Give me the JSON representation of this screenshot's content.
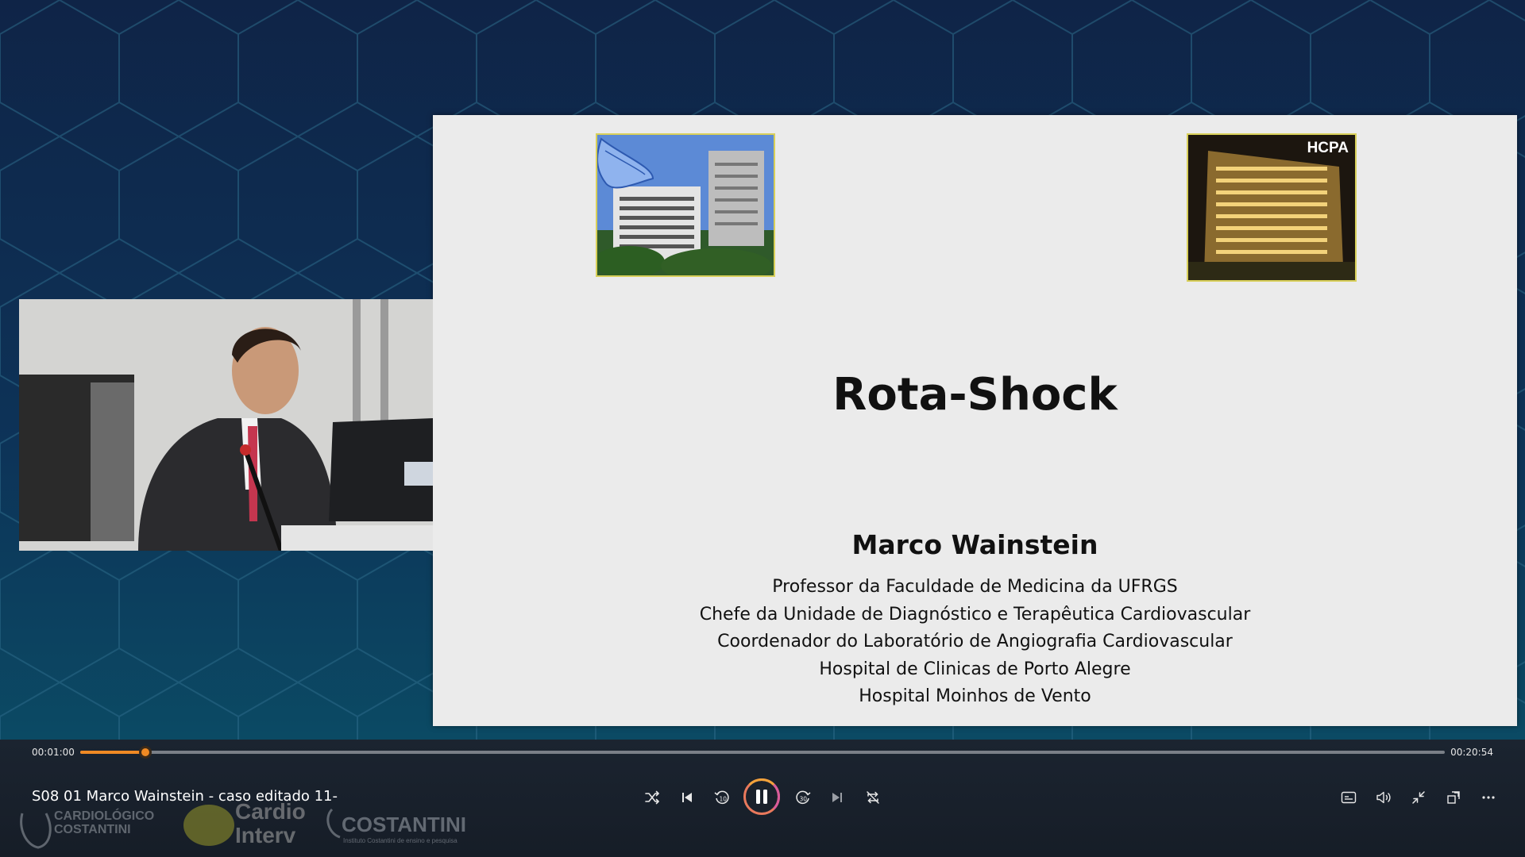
{
  "slide": {
    "title": "Rota-Shock",
    "presenter": "Marco Wainstein",
    "affiliations": [
      "Professor da Faculdade de Medicina da UFRGS",
      "Chefe da Unidade de Diagnóstico e Terapêutica Cardiovascular",
      "Coordenador do Laboratório de Angiografia Cardiovascular",
      "Hospital de Clinicas de Porto Alegre",
      "Hospital Moinhos de Vento"
    ],
    "right_photo_label": "HCPA"
  },
  "player": {
    "current_time": "00:01:00",
    "total_time": "00:20:54",
    "progress": 0.048,
    "video_title": "S08 01 Marco Wainstein - caso editado 11-",
    "accent_color": "#f08a24",
    "controls": [
      {
        "name": "shuffle",
        "icon": "shuffle-icon"
      },
      {
        "name": "previous",
        "icon": "skip-previous-icon"
      },
      {
        "name": "rewind-10",
        "icon": "rewind-10-icon"
      },
      {
        "name": "pause",
        "icon": "pause-icon"
      },
      {
        "name": "forward-30",
        "icon": "forward-30-icon"
      },
      {
        "name": "next",
        "icon": "skip-next-icon"
      },
      {
        "name": "repeat-off",
        "icon": "repeat-off-icon"
      }
    ],
    "right_controls": [
      {
        "name": "captions",
        "icon": "captions-icon"
      },
      {
        "name": "volume",
        "icon": "volume-icon"
      },
      {
        "name": "exit-fullscreen",
        "icon": "exit-fullscreen-icon"
      },
      {
        "name": "mini-player",
        "icon": "mini-player-icon"
      },
      {
        "name": "more",
        "icon": "more-icon"
      }
    ],
    "rewind_seconds": "10",
    "forward_seconds": "30"
  },
  "watermark_logos": {
    "logo1": [
      "CARDIOLÓGICO",
      "COSTANTINI"
    ],
    "logo2": [
      "Cardio",
      "Interv"
    ],
    "logo3": [
      "COSTANTINI",
      "Instituto Costantini de ensino e pesquisa"
    ]
  }
}
